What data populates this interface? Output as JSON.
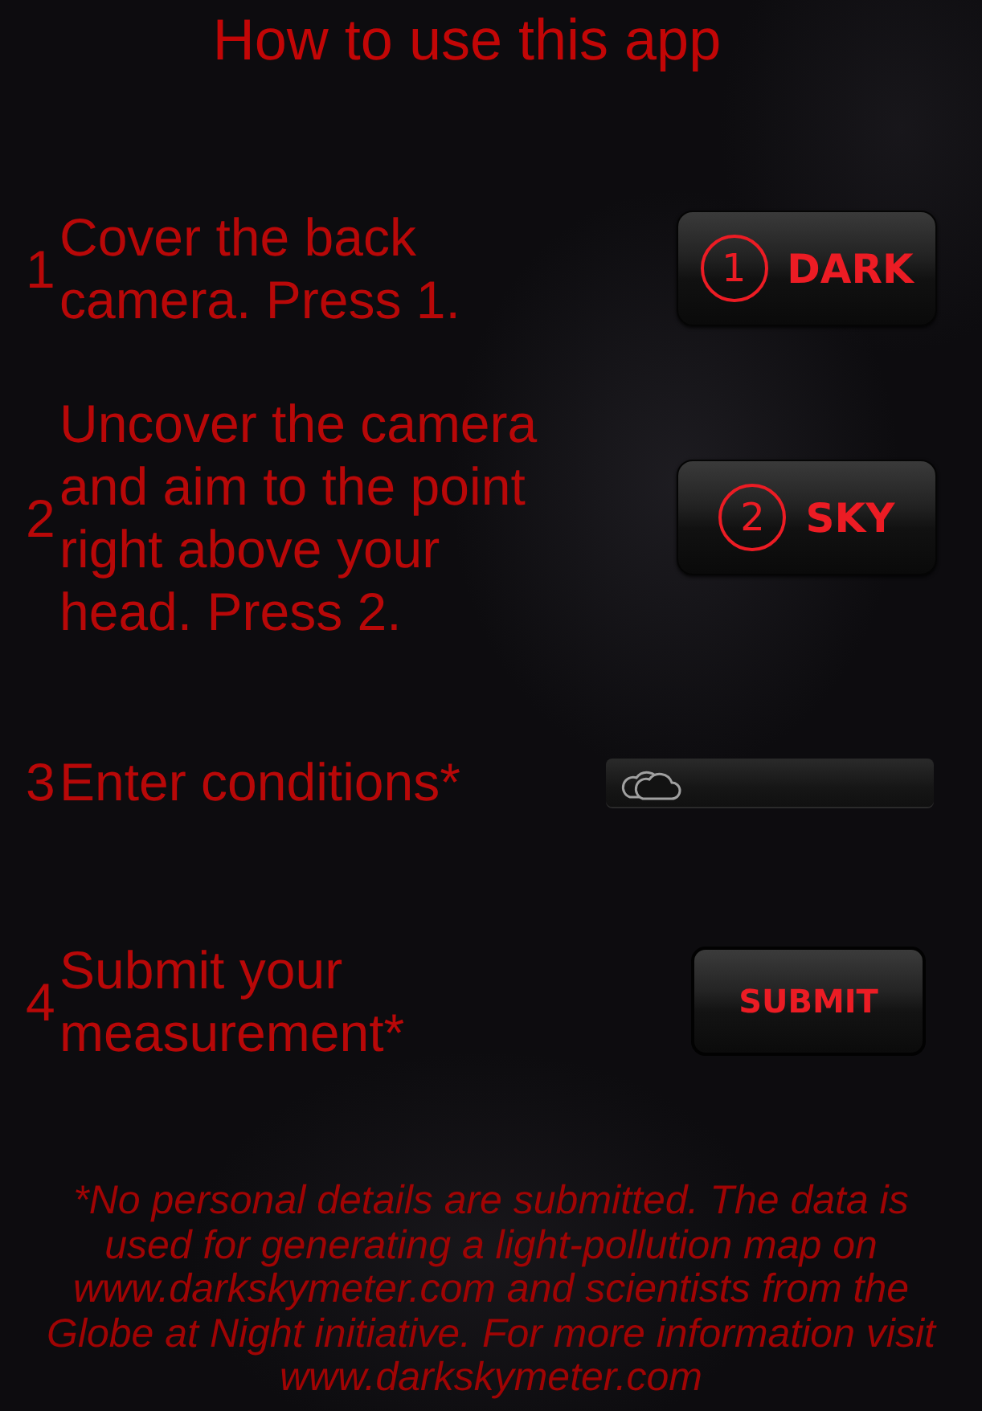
{
  "title": "How to use this app",
  "steps": [
    {
      "number": "1",
      "text": "Cover the back camera. Press 1.",
      "control": {
        "kind": "step_button",
        "badge": "1",
        "label": "DARK"
      }
    },
    {
      "number": "2",
      "text": "Uncover the camera and aim to the point right above your head. Press 2.",
      "control": {
        "kind": "step_button",
        "badge": "2",
        "label": "SKY"
      }
    },
    {
      "number": "3",
      "text": "Enter conditions*",
      "control": {
        "kind": "field"
      }
    },
    {
      "number": "4",
      "text": "Submit your measurement*",
      "control": {
        "kind": "submit_button",
        "label": "SUBMIT"
      }
    }
  ],
  "footnote": "*No personal details are submitted. The data is used for generating a light-pollution map on www.darkskymeter.com and scientists from the Globe at Night initiative. For more information visit www.darkskymeter.com"
}
